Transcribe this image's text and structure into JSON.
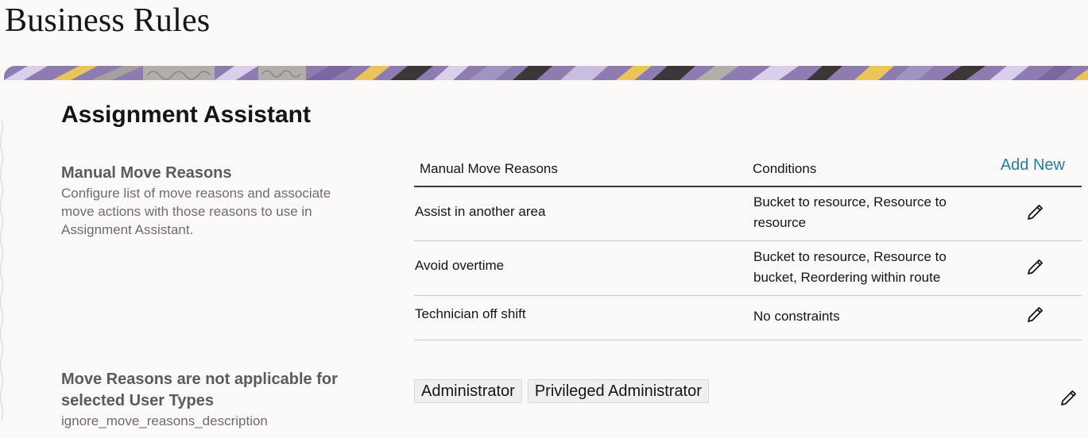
{
  "page": {
    "title": "Business Rules"
  },
  "section": {
    "title": "Assignment Assistant"
  },
  "manual_move_reasons": {
    "label": "Manual Move Reasons",
    "description": "Configure list of move reasons and associate move actions with those reasons to use in Assignment Assistant.",
    "table": {
      "headers": {
        "reason": "Manual Move Reasons",
        "conditions": "Conditions"
      },
      "add_new_label": "Add New",
      "rows": [
        {
          "reason": "Assist in another area",
          "conditions": "Bucket to resource, Resource to resource"
        },
        {
          "reason": "Avoid overtime",
          "conditions": "Bucket to resource, Resource to bucket, Reordering within route"
        },
        {
          "reason": "Technician off shift",
          "conditions": "No constraints"
        }
      ]
    }
  },
  "ignore_move_reasons": {
    "label": "Move Reasons are not applicable for selected User Types",
    "description": "ignore_move_reasons_description",
    "user_types": [
      "Administrator",
      "Privileged Administrator"
    ]
  },
  "icons": {
    "edit": "pencil-icon"
  },
  "colors": {
    "accent_link": "#227e9e",
    "background": "#fbf9f8",
    "banner_purple": "#8e7bb0",
    "banner_yellow": "#e9c55a",
    "banner_dark": "#3b3637"
  }
}
